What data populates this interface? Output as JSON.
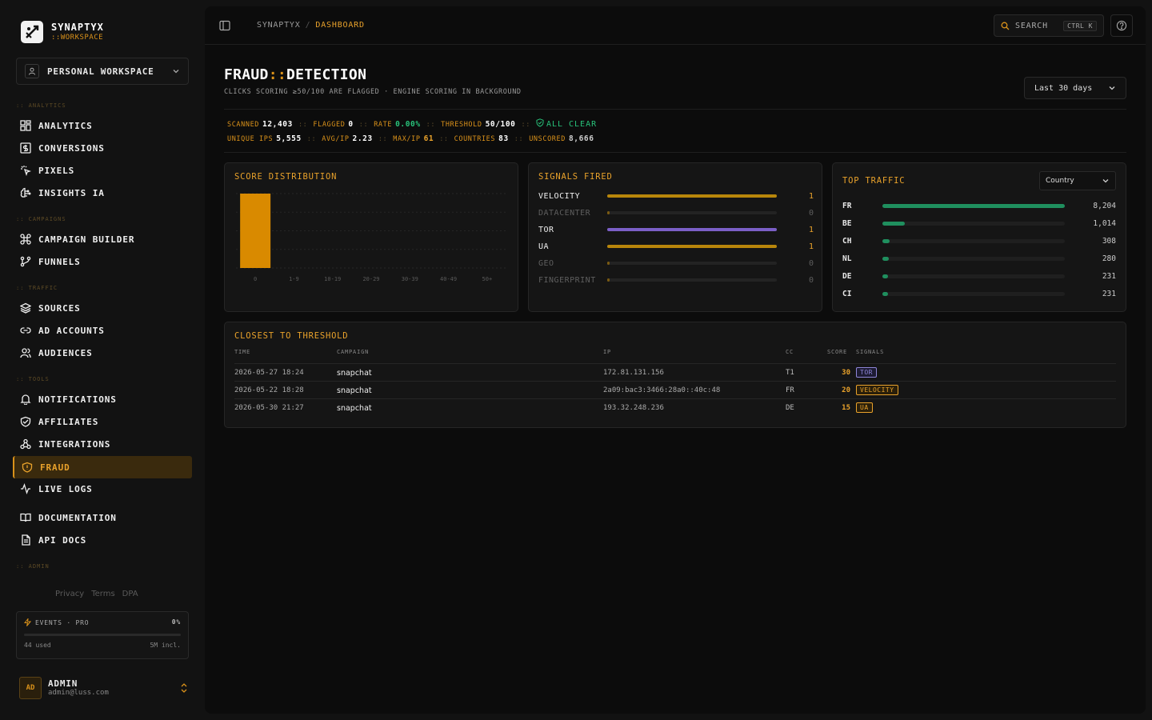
{
  "brand": {
    "name": "SYNAPTYX",
    "sub": "::WORKSPACE"
  },
  "workspace": {
    "label": "PERSONAL WORKSPACE"
  },
  "sections": {
    "analytics": ":: ANALYTICS",
    "campaigns": ":: CAMPAIGNS",
    "traffic": ":: TRAFFIC",
    "tools": ":: TOOLS",
    "admin": ":: ADMIN"
  },
  "nav": {
    "analytics": "ANALYTICS",
    "conversions": "CONVERSIONS",
    "pixels": "PIXELS",
    "insights": "INSIGHTS IA",
    "campaign_builder": "CAMPAIGN BUILDER",
    "funnels": "FUNNELS",
    "sources": "SOURCES",
    "ad_accounts": "AD ACCOUNTS",
    "audiences": "AUDIENCES",
    "notifications": "NOTIFICATIONS",
    "affiliates": "AFFILIATES",
    "integrations": "INTEGRATIONS",
    "fraud": "FRAUD",
    "live_logs": "LIVE LOGS",
    "documentation": "DOCUMENTATION",
    "api_docs": "API DOCS"
  },
  "legal": {
    "privacy": "Privacy",
    "terms": "Terms",
    "dpa": "DPA"
  },
  "events": {
    "label": "EVENTS · PRO",
    "pct": "0%",
    "used": "44 used",
    "incl": "5M incl.",
    "fill": 0.0
  },
  "user": {
    "initials": "AD",
    "name": "ADMIN",
    "email": "admin@luss.com"
  },
  "topbar": {
    "root": "SYNAPTYX",
    "sep": "/",
    "current": "DASHBOARD",
    "search": "SEARCH",
    "shortcut": "CTRL K"
  },
  "page": {
    "title_a": "FRAUD",
    "title_sep": "::",
    "title_b": "DETECTION",
    "subtitle": "CLICKS SCORING ≥50/100 ARE FLAGGED · ENGINE SCORING IN BACKGROUND",
    "range": "Last 30 days"
  },
  "stats1": {
    "scanned_k": "SCANNED",
    "scanned_v": "12,403",
    "flagged_k": "FLAGGED",
    "flagged_v": "0",
    "rate_k": "RATE",
    "rate_v": "0.00%",
    "threshold_k": "THRESHOLD",
    "threshold_v": "50/100",
    "status": "ALL CLEAR"
  },
  "stats2": {
    "unique_k": "UNIQUE IPS",
    "unique_v": "5,555",
    "avg_k": "AVG/IP",
    "avg_v": "2.23",
    "max_k": "MAX/IP",
    "max_v": "61",
    "countries_k": "COUNTRIES",
    "countries_v": "83",
    "unscored_k": "UNSCORED",
    "unscored_v": "8,666"
  },
  "sep": "::",
  "score_dist": {
    "title": "SCORE DISTRIBUTION"
  },
  "chart_data": {
    "type": "bar",
    "title": "SCORE DISTRIBUTION",
    "categories": [
      "0",
      "1-9",
      "10-19",
      "20-29",
      "30-39",
      "40-49",
      "50+"
    ],
    "values": [
      1,
      0,
      0,
      0,
      0,
      0,
      0
    ],
    "color": "#d98a00",
    "grid": true
  },
  "signals": {
    "title": "SIGNALS FIRED",
    "rows": [
      {
        "name": "VELOCITY",
        "value": "1",
        "fill": 1,
        "color": "#b8860b",
        "active": true
      },
      {
        "name": "DATACENTER",
        "value": "0",
        "fill": 0,
        "color": "#b8860b",
        "active": false
      },
      {
        "name": "TOR",
        "value": "1",
        "fill": 1,
        "color": "#7b5fc7",
        "active": true
      },
      {
        "name": "UA",
        "value": "1",
        "fill": 1,
        "color": "#b8860b",
        "active": true
      },
      {
        "name": "GEO",
        "value": "0",
        "fill": 0,
        "color": "#b8860b",
        "active": false
      },
      {
        "name": "FINGERPRINT",
        "value": "0",
        "fill": 0,
        "color": "#b8860b",
        "active": false
      }
    ]
  },
  "top_traffic": {
    "title": "TOP TRAFFIC",
    "selector": "Country",
    "rows": [
      {
        "cc": "FR",
        "value": "8,204",
        "fill": 1.0
      },
      {
        "cc": "BE",
        "value": "1,014",
        "fill": 0.124
      },
      {
        "cc": "CH",
        "value": "308",
        "fill": 0.038
      },
      {
        "cc": "NL",
        "value": "280",
        "fill": 0.034
      },
      {
        "cc": "DE",
        "value": "231",
        "fill": 0.028
      },
      {
        "cc": "CI",
        "value": "231",
        "fill": 0.028
      }
    ]
  },
  "closest": {
    "title": "CLOSEST TO THRESHOLD",
    "headers": {
      "time": "TIME",
      "campaign": "CAMPAIGN",
      "ip": "IP",
      "cc": "CC",
      "score": "SCORE",
      "signals": "SIGNALS"
    },
    "rows": [
      {
        "time": "2026-05-27 18:24",
        "campaign": "snapchat",
        "ip": "172.81.131.156",
        "cc": "T1",
        "score": "30",
        "signal": "TOR",
        "sig_color": "#8f86d9"
      },
      {
        "time": "2026-05-22 18:28",
        "campaign": "snapchat",
        "ip": "2a09:bac3:3466:28a0::40c:48",
        "cc": "FR",
        "score": "20",
        "signal": "VELOCITY",
        "sig_color": "#e9a22b"
      },
      {
        "time": "2026-05-30 21:27",
        "campaign": "snapchat",
        "ip": "193.32.248.236",
        "cc": "DE",
        "score": "15",
        "signal": "UA",
        "sig_color": "#e9a22b"
      }
    ]
  },
  "colors": {
    "accent": "#d9911a",
    "green": "#28c27a",
    "bg": "#0c0c0c"
  }
}
